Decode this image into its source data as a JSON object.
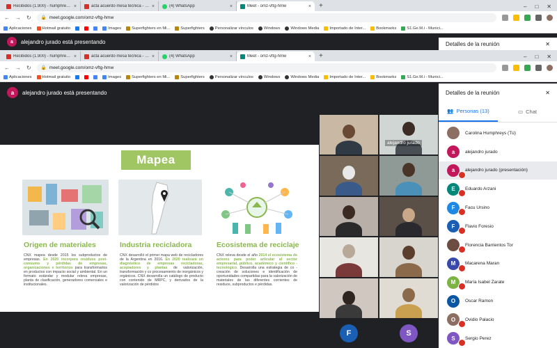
{
  "tabs": [
    {
      "label": "Recibidos (1.900) - humphreyscaro",
      "color": "#d93025"
    },
    {
      "label": "acta acuerdo mesa técnica - chu",
      "color": "#d93025"
    },
    {
      "label": "(4) WhatsApp",
      "color": "#25d366"
    },
    {
      "label": "Meet - omz-vftg-hmw",
      "color": "#00897b"
    }
  ],
  "url": "meet.google.com/omz-vftg-hmw",
  "bookmarks": [
    "Aplicaciones",
    "Hotmail gratuito",
    "Images",
    "Superfighters en Mi...",
    "Superfighters",
    "Personalizar vínculos",
    "Windows",
    "Windows Media",
    "Importado de Inter...",
    "Bookmarks",
    "S1.Ge.M.i - Munici..."
  ],
  "presenter": {
    "initial": "a",
    "text": "alejandro jurado está presentando"
  },
  "sidebar_title": "Detalles de la reunión",
  "slide": {
    "title": "Mapea",
    "columns": [
      {
        "heading": "Origen de materiales",
        "text": "CNX mapea desde 2015 los subproductos de empresas.",
        "highlight": "En 2020 incorpora residuos post-consumo y pérdidas de empresas, organizaciones e territorios",
        "text2": "para transformarlos en productos con impacto social y ambiental. En un formato estándar y modular releva empresas, planta de clasificación, generadores comerciales e institucionales."
      },
      {
        "heading": "Industria recicladora",
        "text": "CNX desarrolló el primer mapa web de recicladores de la Argentina en 2016.",
        "highlight": "En 2020 realizará un diagnóstico de empresas recicladoras, acopiadores y plantas",
        "text2": "de valorización, transformación y co procesamiento de inorgánicos y orgánicos. CNX desarrolla un catálogo de producto con contenido de MRPC, y derivados de la valorización de pérdidos"
      },
      {
        "heading": "Ecosistema de reciclaje",
        "text": "CNX releva desde el año",
        "highlight": "2014 el ecosistema de actores para poder articular al sector empresarial, público, académico y científico - tecnológico.",
        "text2": "Desarrolla una estrategia de co - creación de soluciones e identificación de oportunidades compartidas para la valorización de materiales de las diferentes corrientes de residuos, subproductos e pérdidas."
      }
    ]
  },
  "video_tile_label": "alejandro jurado",
  "bottom_tiles": [
    {
      "initial": "F",
      "color": "#1a5fb4"
    },
    {
      "initial": "S",
      "color": "#7e57c2"
    }
  ],
  "people_tab": "Personas (13)",
  "chat_tab": "Chat",
  "participants": [
    {
      "name": "Carolina Humphreys (Tú)",
      "initial": "",
      "color": "#8d6e63",
      "photo": true,
      "muted": false
    },
    {
      "name": "alejandro jurado",
      "initial": "a",
      "color": "#c2185b",
      "photo": false,
      "muted": false
    },
    {
      "name": "alejandro jurado (presentación)",
      "initial": "a",
      "color": "#c2185b",
      "photo": false,
      "muted": true
    },
    {
      "name": "Eduardo Arzani",
      "initial": "E",
      "color": "#00897b",
      "photo": false,
      "muted": true
    },
    {
      "name": "Facu Ursino",
      "initial": "F",
      "color": "#1e88e5",
      "photo": false,
      "muted": true
    },
    {
      "name": "Flavio Foresio",
      "initial": "F",
      "color": "#1a5fb4",
      "photo": false,
      "muted": true
    },
    {
      "name": "Florencia Barrientos Tor",
      "initial": "",
      "color": "#6d4c41",
      "photo": true,
      "muted": true
    },
    {
      "name": "Macarena Maran",
      "initial": "M",
      "color": "#3949ab",
      "photo": false,
      "muted": true
    },
    {
      "name": "María Isabel Zarate",
      "initial": "M",
      "color": "#7cb342",
      "photo": false,
      "muted": true
    },
    {
      "name": "Oscar Ramon",
      "initial": "O",
      "color": "#0b57a4",
      "photo": false,
      "muted": false
    },
    {
      "name": "Ovidio Palacio",
      "initial": "O",
      "color": "#8d6e63",
      "photo": false,
      "muted": true
    },
    {
      "name": "Sergio Perez",
      "initial": "S",
      "color": "#7e57c2",
      "photo": false,
      "muted": true
    }
  ]
}
